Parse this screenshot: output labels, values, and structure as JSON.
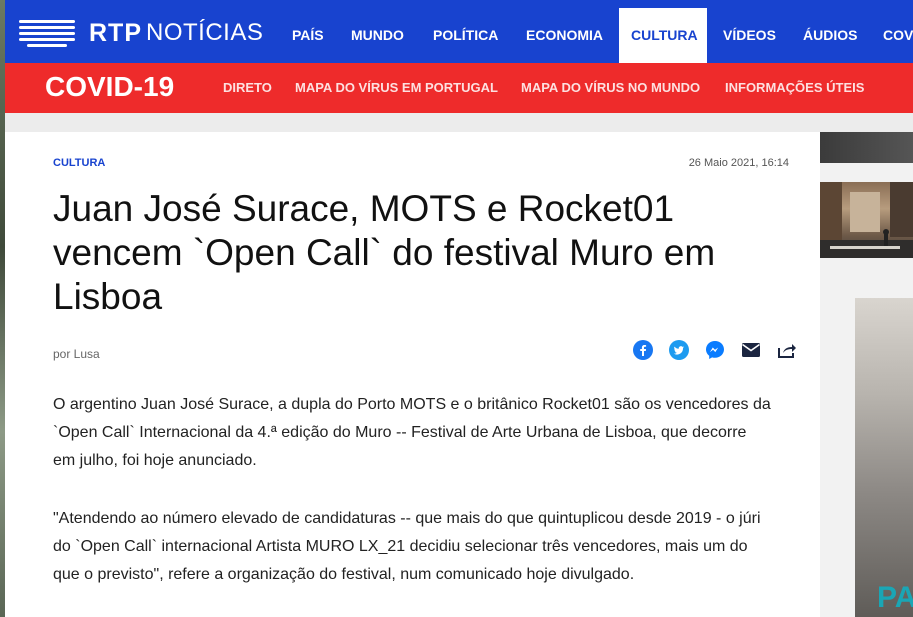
{
  "header": {
    "logo_rtp": "RTP",
    "logo_noticias": "NOTÍCIAS",
    "nav": [
      {
        "label": "PAÍS"
      },
      {
        "label": "MUNDO"
      },
      {
        "label": "POLÍTICA"
      },
      {
        "label": "ECONOMIA"
      },
      {
        "label": "CULTURA",
        "active": true
      },
      {
        "label": "VÍDEOS"
      },
      {
        "label": "ÁUDIOS"
      },
      {
        "label": "COV"
      }
    ],
    "brand_color": "#1843cf"
  },
  "covid": {
    "title": "COVID-19",
    "links": [
      {
        "label": "DIRETO"
      },
      {
        "label": "MAPA DO VÍRUS EM PORTUGAL"
      },
      {
        "label": "MAPA DO VÍRUS NO MUNDO"
      },
      {
        "label": "INFORMAÇÕES ÚTEIS"
      }
    ],
    "color": "#ee2b2b"
  },
  "article": {
    "section": "CULTURA",
    "date": "26 Maio 2021, 16:14",
    "headline": "Juan José Surace, MOTS e Rocket01 vencem `Open Call` do festival Muro em Lisboa",
    "byline": "por Lusa",
    "share_icons": [
      "facebook-icon",
      "twitter-icon",
      "messenger-icon",
      "email-icon",
      "share-icon"
    ],
    "paragraphs": [
      "O argentino Juan José Surace, a dupla do Porto MOTS e o britânico Rocket01 são os vencedores da `Open Call` Internacional da 4.ª edição do Muro -- Festival de Arte Urbana de Lisboa, que decorre em julho, foi hoje anunciado.",
      "\"Atendendo ao número elevado de candidaturas -- que mais do que quintuplicou desde 2019 - o júri do `Open Call` internacional Artista MURO LX_21 decidiu selecionar três vencedores, mais um do que o previsto\", refere a organização do festival, num comunicado hoje divulgado."
    ]
  },
  "sidebar": {
    "ad_text": "PA"
  }
}
